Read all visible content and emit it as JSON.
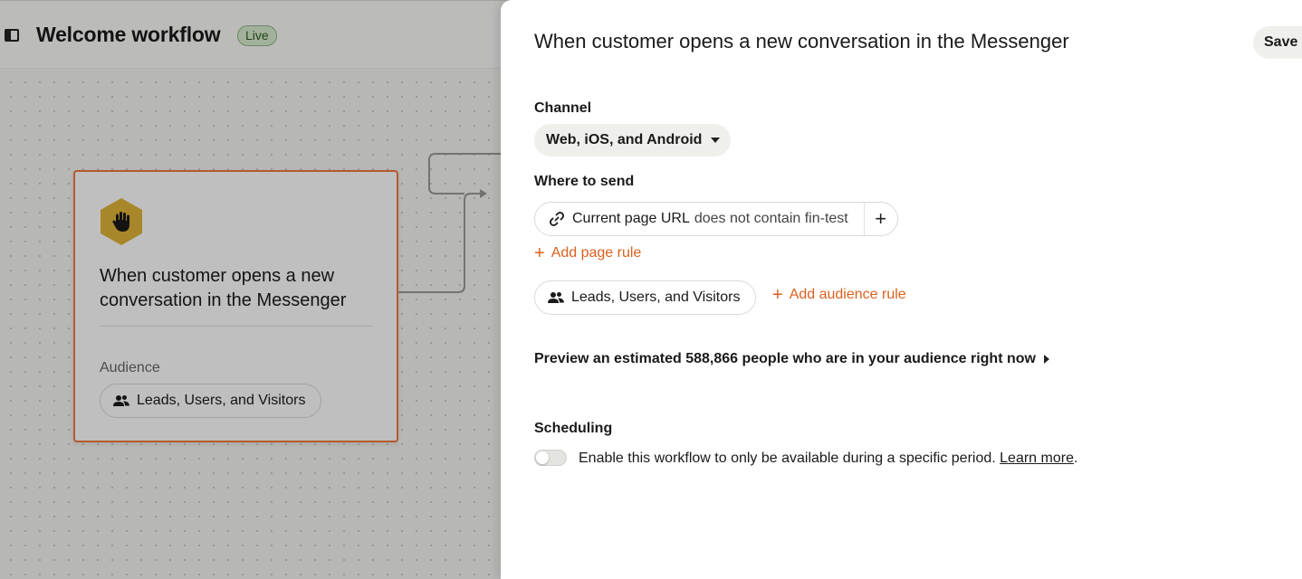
{
  "header": {
    "title": "Welcome workflow",
    "status_badge": "Live"
  },
  "canvas": {
    "trigger_card": {
      "title": "When customer opens a new conversation in the Messenger",
      "audience_label": "Audience",
      "audience_value": "Leads, Users, and Visitors",
      "icon": "hand-wave-icon",
      "accent_color": "#f0793c",
      "icon_color": "#e0b53a"
    }
  },
  "panel": {
    "title": "When customer opens a new conversation in the Messenger",
    "save_label": "Save",
    "channel": {
      "label": "Channel",
      "value": "Web, iOS, and Android"
    },
    "where_to_send": {
      "label": "Where to send",
      "rule_attribute": "Current page URL",
      "rule_condition": "does not contain fin-test",
      "add_page_rule": "Add page rule",
      "audience_value": "Leads, Users, and Visitors",
      "add_audience_rule": "Add audience rule"
    },
    "preview_text": "Preview an estimated 588,866 people who are in your audience right now",
    "scheduling": {
      "label": "Scheduling",
      "enabled": false,
      "description": "Enable this workflow to only be available during a specific period.",
      "learn_more": "Learn more",
      "trailing": "."
    },
    "link_color": "#d9611e"
  }
}
